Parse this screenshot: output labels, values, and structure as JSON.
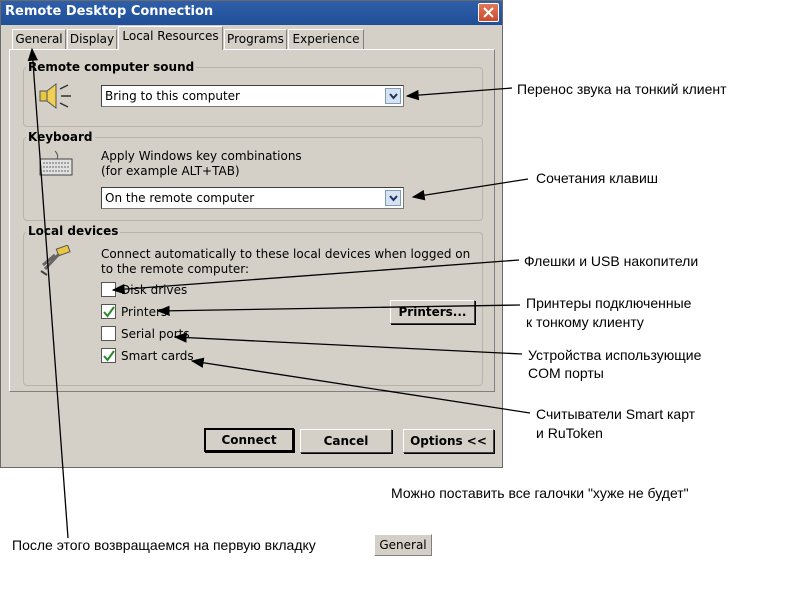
{
  "window": {
    "title": "Remote Desktop Connection"
  },
  "tabs": [
    {
      "label": "General"
    },
    {
      "label": "Display"
    },
    {
      "label": "Local Resources"
    },
    {
      "label": "Programs"
    },
    {
      "label": "Experience"
    }
  ],
  "sound": {
    "title": "Remote computer sound",
    "selected": "Bring to this computer"
  },
  "keyboard": {
    "title": "Keyboard",
    "desc_line1": "Apply Windows key combinations",
    "desc_line2": "(for example ALT+TAB)",
    "selected": "On the remote computer"
  },
  "devices": {
    "title": "Local devices",
    "desc_line1": "Connect automatically to these local devices when logged on",
    "desc_line2": "to the remote computer:",
    "items": [
      {
        "label": "Disk drives",
        "checked": false
      },
      {
        "label": "Printers",
        "checked": true
      },
      {
        "label": "Serial ports",
        "checked": false
      },
      {
        "label": "Smart cards",
        "checked": true
      }
    ],
    "printers_button": "Printers..."
  },
  "buttons": {
    "connect": "Connect",
    "cancel": "Cancel",
    "options": "Options <<"
  },
  "annotations": {
    "sound": "Перенос звука на тонкий клиент",
    "keyboard": "Сочетания клавиш",
    "disk": "Флешки и USB накопители",
    "printers_line1": "Принтеры подключенные",
    "printers_line2": "к тонкому клиенту",
    "serial_line1": "Устройства использующие",
    "serial_line2": "COM порты",
    "smart_line1": "Считыватели Smart карт",
    "smart_line2": "и RuToken",
    "all_checks": "Можно поставить все галочки \"хуже не будет\"",
    "return": "После этого возвращаемся на первую вкладку",
    "return_tab": "General"
  },
  "colors": {
    "titlebar": "#1f4f97",
    "window_bg": "#d4d0c8",
    "check": "#2a8a2a"
  }
}
